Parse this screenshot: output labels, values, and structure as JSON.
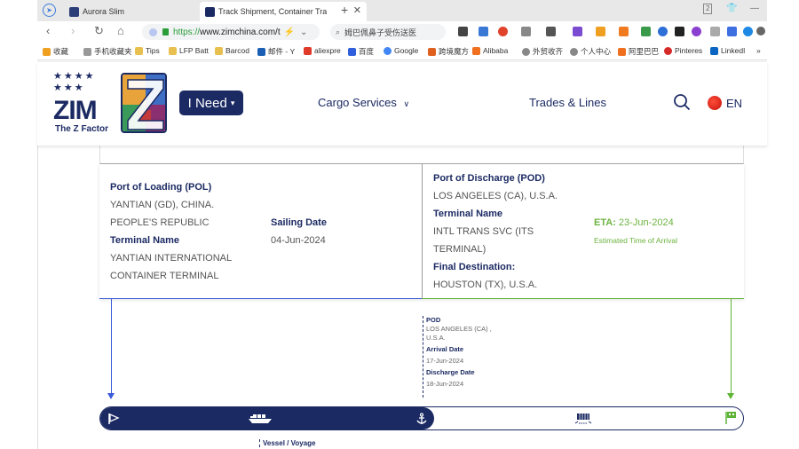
{
  "browser": {
    "tabs": [
      {
        "title": "Aurora Slim",
        "active": false
      },
      {
        "title": "Track Shipment, Container Tra",
        "active": true
      }
    ],
    "new_tab": "+",
    "window_badge": "2",
    "url_scheme": "https://",
    "url_host": "www.zimchina.com/t",
    "search_text": "姆巴佩鼻子受伤送医",
    "bookmarks": [
      "收藏",
      "手机收藏夹",
      "Tips",
      "LFP Batt",
      "Barcod",
      "邮件 - Y",
      "aliexpre",
      "百度",
      "Google",
      "跨境魔方",
      "Alibaba",
      "外贸收齐",
      "个人中心",
      "阿里巴巴",
      "Pinteres",
      "LinkedI"
    ],
    "overflow": "»",
    "accent_green": "#2a9d3a"
  },
  "site": {
    "logo_word": "ZIM",
    "logo_tag": "The Z Factor",
    "stars": "★★★★\n★★★",
    "i_need": "I Need",
    "nav": {
      "cargo_services": "Cargo Services",
      "trades_lines": "Trades & Lines"
    },
    "lang": "EN",
    "brand_color": "#1b2a63"
  },
  "shipment": {
    "pol": {
      "label": "Port of Loading (POL)",
      "line1": "YANTIAN (GD), CHINA.",
      "line2": "PEOPLE'S REPUBLIC",
      "terminal_label": "Terminal Name",
      "terminal_line1": "YANTIAN INTERNATIONAL",
      "terminal_line2": "CONTAINER TERMINAL"
    },
    "sailing": {
      "label": "Sailing Date",
      "value": "04-Jun-2024"
    },
    "pod": {
      "label": "Port of Discharge (POD)",
      "value": "LOS ANGELES (CA), U.S.A.",
      "terminal_label": "Terminal Name",
      "terminal_line1": "INTL TRANS SVC (ITS",
      "terminal_line2": "TERMINAL)",
      "final_label": "Final Destination:",
      "final_value": "HOUSTON (TX), U.S.A."
    },
    "eta": {
      "label": "ETA:",
      "value": "23-Jun-2024",
      "sub": "Estimated Time of Arrival",
      "color": "#6cb33f"
    }
  },
  "timeline": {
    "pod_label": "POD",
    "pod_line1": "LOS ANGELES (CA) ,",
    "pod_line2": "U.S.A.",
    "arrival_label": "Arrival Date",
    "arrival_value": "17-Jun-2024",
    "discharge_label": "Discharge Date",
    "discharge_value": "18-Jun-2024",
    "vessel_label": "Vessel / Voyage",
    "progress_fraction": 0.52,
    "colors": {
      "origin": "#3a5bd9",
      "destination": "#5fb336"
    }
  }
}
